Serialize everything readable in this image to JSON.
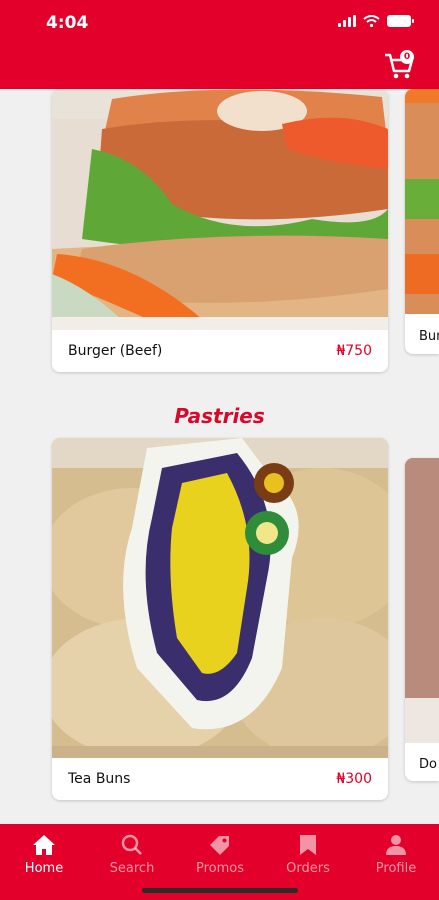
{
  "status_bar": {
    "time": "4:04"
  },
  "header": {
    "cart_count": "0"
  },
  "sections": [
    {
      "title": ""
    },
    {
      "title": "Pastries"
    }
  ],
  "items": [
    {
      "name": "Burger (Beef)",
      "price": "₦750"
    },
    {
      "name": "Bur",
      "price": ""
    },
    {
      "name": "Tea Buns",
      "price": "₦300"
    },
    {
      "name": "Do",
      "price": ""
    }
  ],
  "tabs": [
    {
      "label": "Home",
      "icon": "home-icon"
    },
    {
      "label": "Search",
      "icon": "search-icon"
    },
    {
      "label": "Promos",
      "icon": "tag-icon"
    },
    {
      "label": "Orders",
      "icon": "bookmark-icon"
    },
    {
      "label": "Profile",
      "icon": "profile-icon"
    }
  ],
  "colors": {
    "brand": "#e3002a",
    "price": "#e3002a",
    "background": "#f0f0f1"
  }
}
